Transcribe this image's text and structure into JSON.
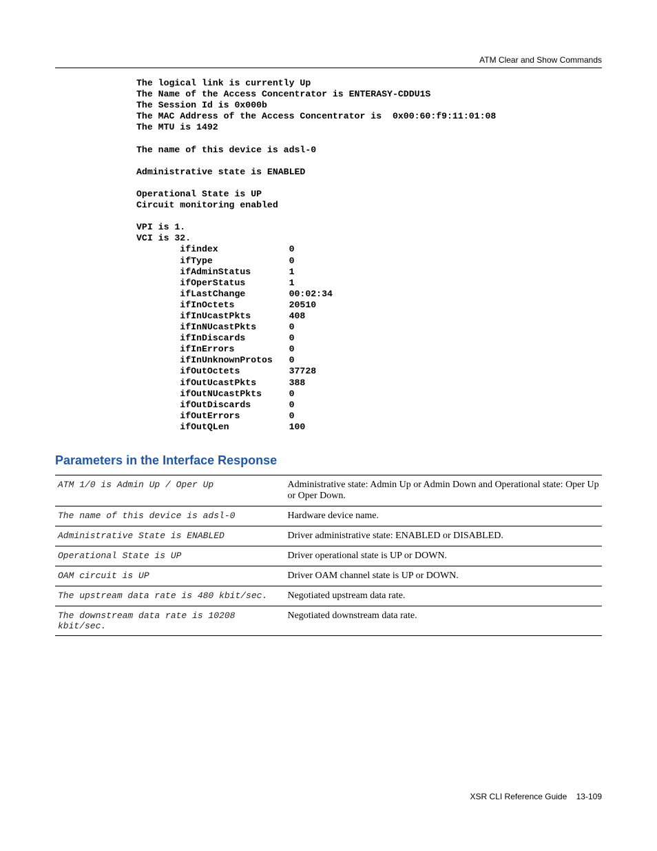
{
  "header": {
    "right": "ATM Clear and Show Commands"
  },
  "code": {
    "lines": [
      "The logical link is currently Up",
      "The Name of the Access Concentrator is ENTERASY-CDDU1S",
      "The Session Id is 0x000b",
      "The MAC Address of the Access Concentrator is  0x00:60:f9:11:01:08",
      "The MTU is 1492",
      "",
      "The name of this device is adsl-0",
      "",
      "Administrative state is ENABLED",
      "",
      "Operational State is UP",
      "Circuit monitoring enabled",
      "",
      "VPI is 1.",
      "VCI is 32."
    ],
    "stats": [
      {
        "k": "ifindex",
        "v": "0"
      },
      {
        "k": "ifType",
        "v": "0"
      },
      {
        "k": "ifAdminStatus",
        "v": "1"
      },
      {
        "k": "ifOperStatus",
        "v": "1"
      },
      {
        "k": "ifLastChange",
        "v": "00:02:34"
      },
      {
        "k": "ifInOctets",
        "v": "20510"
      },
      {
        "k": "ifInUcastPkts",
        "v": "408"
      },
      {
        "k": "ifInNUcastPkts",
        "v": "0"
      },
      {
        "k": "ifInDiscards",
        "v": "0"
      },
      {
        "k": "ifInErrors",
        "v": "0"
      },
      {
        "k": "ifInUnknownProtos",
        "v": "0"
      },
      {
        "k": "ifOutOctets",
        "v": "37728"
      },
      {
        "k": "ifOutUcastPkts",
        "v": "388"
      },
      {
        "k": "ifOutNUcastPkts",
        "v": "0"
      },
      {
        "k": "ifOutDiscards",
        "v": "0"
      },
      {
        "k": "ifOutErrors",
        "v": "0"
      },
      {
        "k": "ifOutQLen",
        "v": "100"
      }
    ]
  },
  "section_title": "Parameters in the Interface Response",
  "params": [
    {
      "name": "ATM 1/0 is Admin Up / Oper Up",
      "desc": "Administrative state: Admin Up or Admin Down and Operational state: Oper Up or Oper Down."
    },
    {
      "name": "The name of this device is adsl-0",
      "desc": "Hardware device name."
    },
    {
      "name": "Administrative State is ENABLED",
      "desc": "Driver administrative state: ENABLED or DISABLED."
    },
    {
      "name": "Operational State is UP",
      "desc": "Driver operational state is UP or DOWN."
    },
    {
      "name": "OAM circuit is UP",
      "desc": "Driver OAM channel state is UP or DOWN."
    },
    {
      "name": "The upstream data rate is 480 kbit/sec.",
      "desc": "Negotiated upstream data rate."
    },
    {
      "name": "The downstream data rate is 10208 kbit/sec.",
      "desc": "Negotiated downstream data rate."
    }
  ],
  "footer": {
    "guide": "XSR CLI Reference Guide",
    "pageno": "13-109"
  }
}
